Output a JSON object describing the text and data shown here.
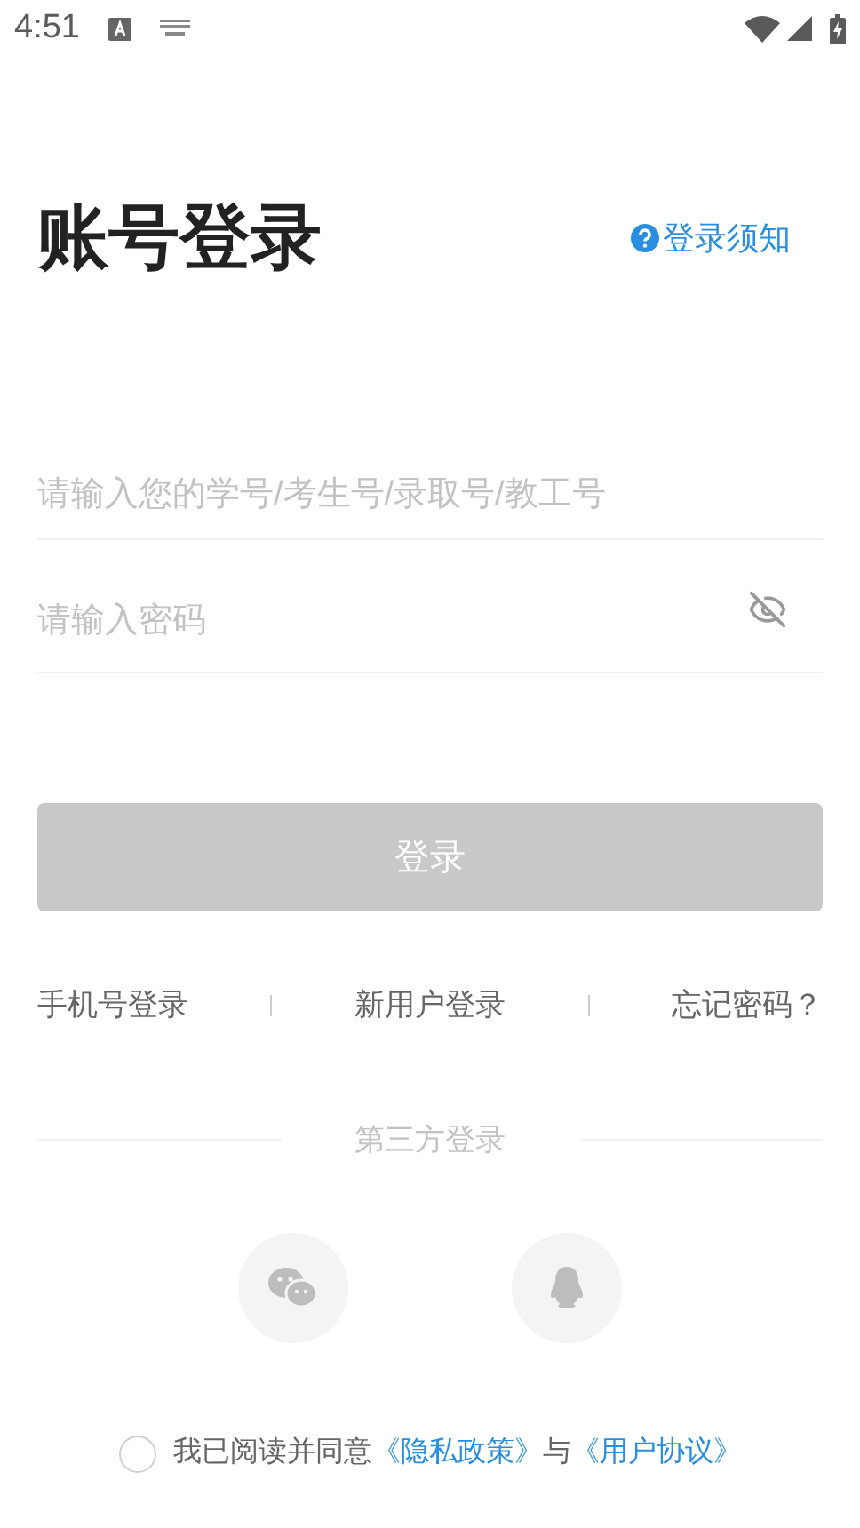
{
  "status_bar": {
    "time": "4:51"
  },
  "title": "账号登录",
  "notice_link": "登录须知",
  "account_field": {
    "placeholder": "请输入您的学号/考生号/录取号/教工号"
  },
  "password_field": {
    "placeholder": "请输入密码",
    "visible": false
  },
  "login_button": {
    "label": "登录",
    "disabled": true
  },
  "links": [
    "手机号登录",
    "新用户登录",
    "忘记密码？"
  ],
  "third_party": {
    "label": "第三方登录",
    "providers": [
      {
        "kind": "wechat"
      },
      {
        "kind": "qq"
      }
    ]
  },
  "agreement": {
    "checked": false,
    "prefix": "我已阅读并同意",
    "privacy": "《隐私政策》",
    "joiner": "与",
    "terms": "《用户协议》"
  }
}
